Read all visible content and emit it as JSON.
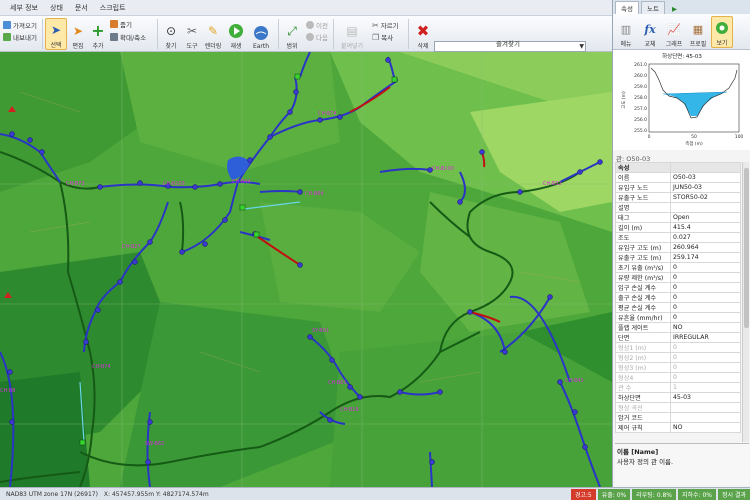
{
  "menu": [
    "세부 정보",
    "상태",
    "문서",
    "스크립트"
  ],
  "ribbon": {
    "import_label": "가져오기",
    "export_label": "내보내기",
    "select": "선택",
    "edit": "편집",
    "add": "추가",
    "zoom_label": "줌기",
    "zoom_fit": "확대/축소",
    "find": "찾기",
    "tools": "도구",
    "render": "렌더링",
    "play": "재생",
    "earth": "Earth",
    "range": "범위",
    "prev": "이전",
    "next": "다음",
    "paste": "붙여넣기",
    "cut": "자르기",
    "copy": "복사",
    "delete": "삭제",
    "favorites": "즐겨찾기",
    "search_value": ""
  },
  "panel": {
    "tabs": [
      "속성",
      "노트",
      "▶"
    ],
    "tools": [
      "메뉴",
      "교체",
      "그래프",
      "프로필",
      "보기"
    ],
    "profile_title": "하상단면: 45-03",
    "profile_ylabel": "고도 (m)",
    "profile_xlabel": "측점 (m)",
    "profile_yticks": [
      "261.0",
      "260.0",
      "259.0",
      "258.0",
      "257.0",
      "256.0",
      "255.0"
    ],
    "profile_xticks": [
      "0",
      "50",
      "100"
    ],
    "props_header": "관: O50-03",
    "desc_title": "이름 [Name]",
    "desc_text": "사용자 정의 관 이름."
  },
  "properties": [
    {
      "k": "속성",
      "v": "",
      "type": "sec"
    },
    {
      "k": "이름",
      "v": "O50-03"
    },
    {
      "k": "유입구 노드",
      "v": "JUN50-03"
    },
    {
      "k": "유출구 노드",
      "v": "STOR50-02"
    },
    {
      "k": "설명",
      "v": ""
    },
    {
      "k": "태그",
      "v": "Open"
    },
    {
      "k": "길이 (m)",
      "v": "415.4"
    },
    {
      "k": "조도",
      "v": "0.027"
    },
    {
      "k": "유입구 고도 (m)",
      "v": "260.964"
    },
    {
      "k": "유출구 고도 (m)",
      "v": "259.174"
    },
    {
      "k": "초기 유출 (m³/s)",
      "v": "0"
    },
    {
      "k": "유량 제한 (m³/s)",
      "v": "0"
    },
    {
      "k": "입구 손실 계수",
      "v": "0"
    },
    {
      "k": "출구 손실 계수",
      "v": "0"
    },
    {
      "k": "평균 손실 계수",
      "v": "0"
    },
    {
      "k": "유흔율 (mm/hr)",
      "v": "0"
    },
    {
      "k": "플랩 게이트",
      "v": "NO"
    },
    {
      "k": "단면",
      "v": "IRREGULAR"
    },
    {
      "k": "형상1 (m)",
      "v": "0",
      "type": "dim"
    },
    {
      "k": "형상2 (m)",
      "v": "0",
      "type": "dim"
    },
    {
      "k": "형상3 (m)",
      "v": "0",
      "type": "dim"
    },
    {
      "k": "형상4",
      "v": "0",
      "type": "dim"
    },
    {
      "k": "관 수",
      "v": "1",
      "type": "dim"
    },
    {
      "k": "하상단면",
      "v": "45-03"
    },
    {
      "k": "형상 곡선",
      "v": "",
      "type": "dim"
    },
    {
      "k": "암거 코드",
      "v": ""
    },
    {
      "k": "제어 규칙",
      "v": "NO"
    }
  ],
  "map_labels": [
    "CH-B72",
    "CH-B105",
    "CH-B44",
    "CH-B74",
    "CH-B64",
    "CH-B100",
    "CH-B32",
    "CH-B27",
    "SY-B61",
    "CH-B74",
    "CH-B8",
    "CH-B61",
    "CH-B18",
    "SW-B62",
    "CH-B45"
  ],
  "status": {
    "crs": "NAD83 UTM zone 17N (26917)",
    "coords": "X: 457457.955m  Y: 4827174.574m",
    "badges": [
      "경고:5",
      "유출: 0%",
      "라우팅: 0.8%",
      "지하수: 0%",
      "정시 결과"
    ]
  },
  "colors": {
    "pipe": "#2a35c6",
    "channel": "#155a15",
    "error": "#c01010"
  }
}
